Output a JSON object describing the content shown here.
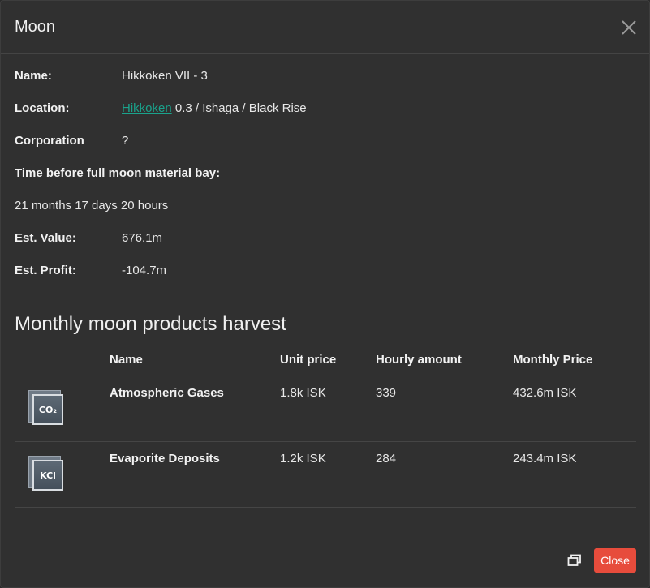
{
  "modal": {
    "title": "Moon",
    "close_icon": "close-icon",
    "restore_icon": "window-restore-icon",
    "close_button_label": "Close",
    "close_button_color": "#e74c3c"
  },
  "info": {
    "name_label": "Name:",
    "name_value": "Hikkoken VII - 3",
    "location_label": "Location:",
    "location_link": "Hikkoken",
    "location_rest": " 0.3 / Ishaga / Black Rise",
    "link_color": "#1aa38c",
    "corporation_label": "Corporation",
    "corporation_value": "?",
    "time_label": "Time before full moon material bay:",
    "time_value": "21 months 17 days 20 hours",
    "est_value_label": "Est. Value:",
    "est_value_value": "676.1m",
    "est_profit_label": "Est. Profit:",
    "est_profit_value": "-104.7m"
  },
  "harvest": {
    "title": "Monthly moon products harvest",
    "columns": [
      "Name",
      "Unit price",
      "Hourly amount",
      "Monthly Price"
    ],
    "rows": [
      {
        "icon": "co2-icon",
        "icon_text": "CO₂",
        "name": "Atmospheric Gases",
        "unit_price": "1.8k ISK",
        "hourly_amount": "339",
        "monthly_price": "432.6m ISK"
      },
      {
        "icon": "kcl-icon",
        "icon_text": "KCl",
        "name": "Evaporite Deposits",
        "unit_price": "1.2k ISK",
        "hourly_amount": "284",
        "monthly_price": "243.4m ISK"
      }
    ]
  }
}
